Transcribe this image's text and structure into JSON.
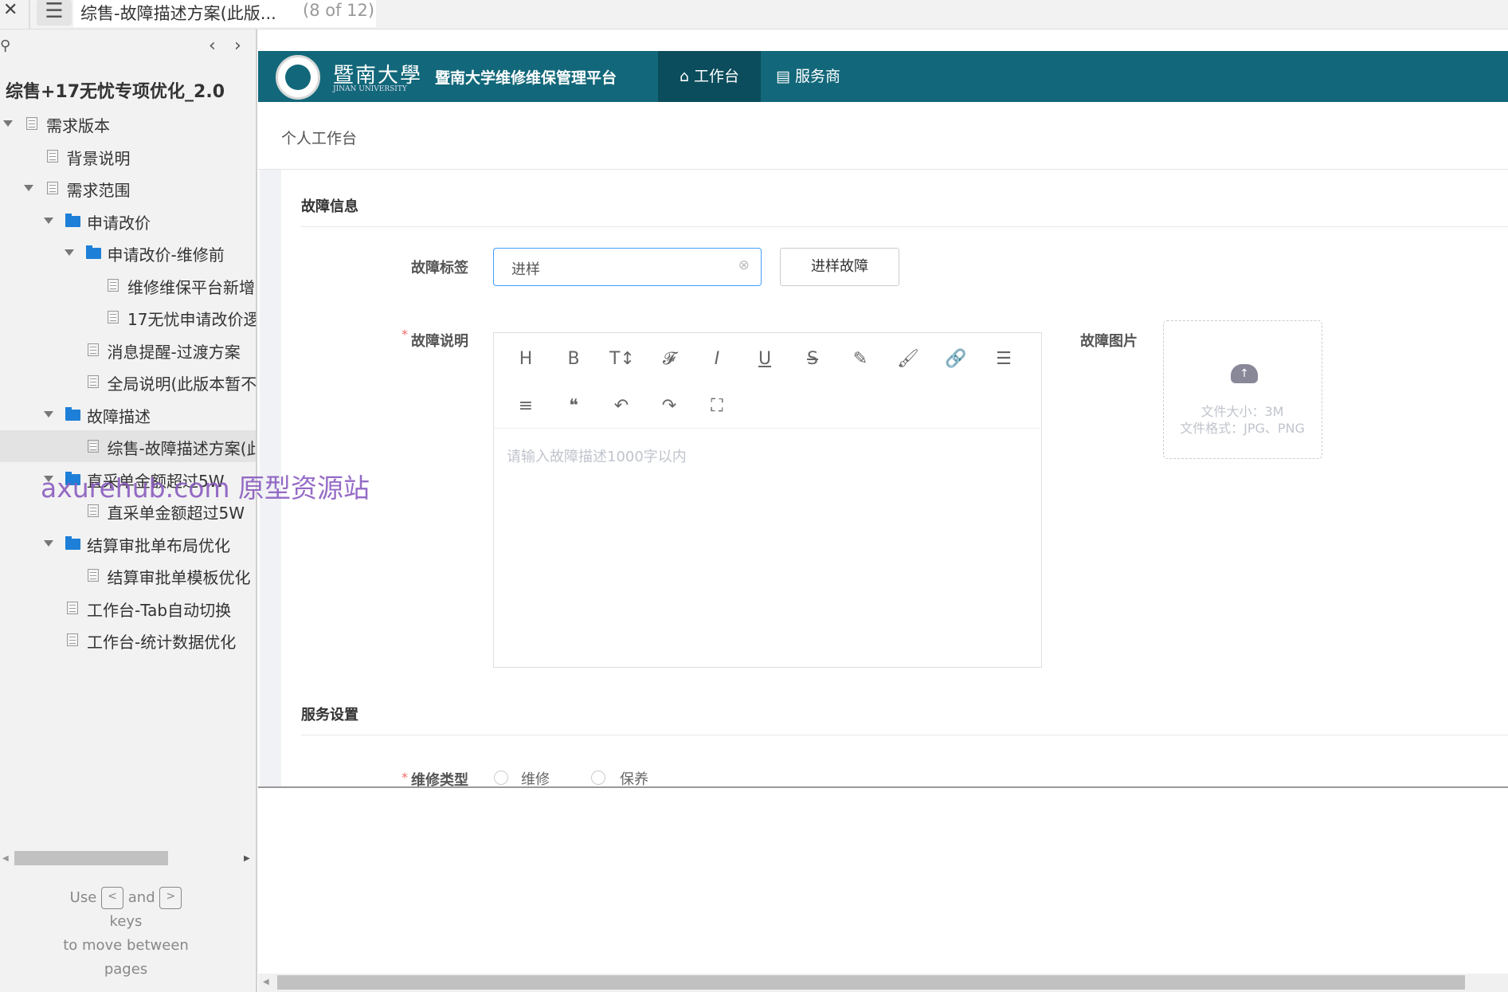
{
  "topbar": {
    "close_icon": "close-icon",
    "menu_icon": "hamburger-icon",
    "page_title": "综售-故障描述方案(此版...",
    "page_count": "(8 of 12)"
  },
  "sidebar": {
    "project_title": "综售+17无忧专项优化_2.0",
    "tree": [
      {
        "label": "需求版本",
        "type": "page",
        "expanded": true
      },
      {
        "label": "背景说明",
        "type": "page"
      },
      {
        "label": "需求范围",
        "type": "page",
        "expanded": true
      },
      {
        "label": "申请改价",
        "type": "folder",
        "expanded": true
      },
      {
        "label": "申请改价-维修前",
        "type": "folder",
        "expanded": true
      },
      {
        "label": "维修维保平台新增",
        "type": "page"
      },
      {
        "label": "17无忧申请改价逻",
        "type": "page"
      },
      {
        "label": "消息提醒-过渡方案",
        "type": "page"
      },
      {
        "label": "全局说明(此版本暂不",
        "type": "page"
      },
      {
        "label": "故障描述",
        "type": "folder",
        "expanded": true
      },
      {
        "label": "综售-故障描述方案(此",
        "type": "page",
        "selected": true
      },
      {
        "label": "直采单金额超过5W",
        "type": "folder",
        "expanded": true
      },
      {
        "label": "直采单金额超过5W",
        "type": "page"
      },
      {
        "label": "结算审批单布局优化",
        "type": "folder",
        "expanded": true
      },
      {
        "label": "结算审批单模板优化",
        "type": "page"
      },
      {
        "label": "工作台-Tab自动切换",
        "type": "page"
      },
      {
        "label": "工作台-统计数据优化",
        "type": "page"
      }
    ],
    "help": {
      "use": "Use",
      "prev_key": "<",
      "and": "and",
      "next_key": ">",
      "keys": "keys",
      "line3": "to move between",
      "line4": "pages"
    }
  },
  "watermark": "axurehub.com 原型资源站",
  "app": {
    "colors": {
      "header": "#12687a",
      "active_tab": "#0b4d5c",
      "primary": "#409eff",
      "required": "#f56c6c"
    },
    "logo_name": "暨南大學",
    "logo_sub": "JINAN UNIVERSITY",
    "platform_title": "暨南大学维修维保管理平台",
    "nav": [
      {
        "label": "工作台",
        "icon": "home-icon",
        "active": true
      },
      {
        "label": "服务商",
        "icon": "store-icon"
      }
    ],
    "breadcrumb": "个人工作台",
    "fault_section": "故障信息",
    "fault_tag_label": "故障标签",
    "fault_tag_value": "进样",
    "fault_tag_button": "进样故障",
    "fault_desc_label": "故障说明",
    "required_mark": "*",
    "toolbar": [
      "H",
      "B",
      "T↕",
      "𝓕",
      "I",
      "U",
      "S",
      "✎",
      "🖌",
      "🔗",
      "☰",
      "≡",
      "❝",
      "↶",
      "↷",
      "⛶"
    ],
    "desc_placeholder": "请输入故障描述1000字以内",
    "fault_image_label": "故障图片",
    "upload_size": "文件大小：3M",
    "upload_format": "文件格式：JPG、PNG",
    "service_section": "服务设置",
    "repair_type_label": "维修类型",
    "repair_options": [
      "维修",
      "保养"
    ]
  }
}
